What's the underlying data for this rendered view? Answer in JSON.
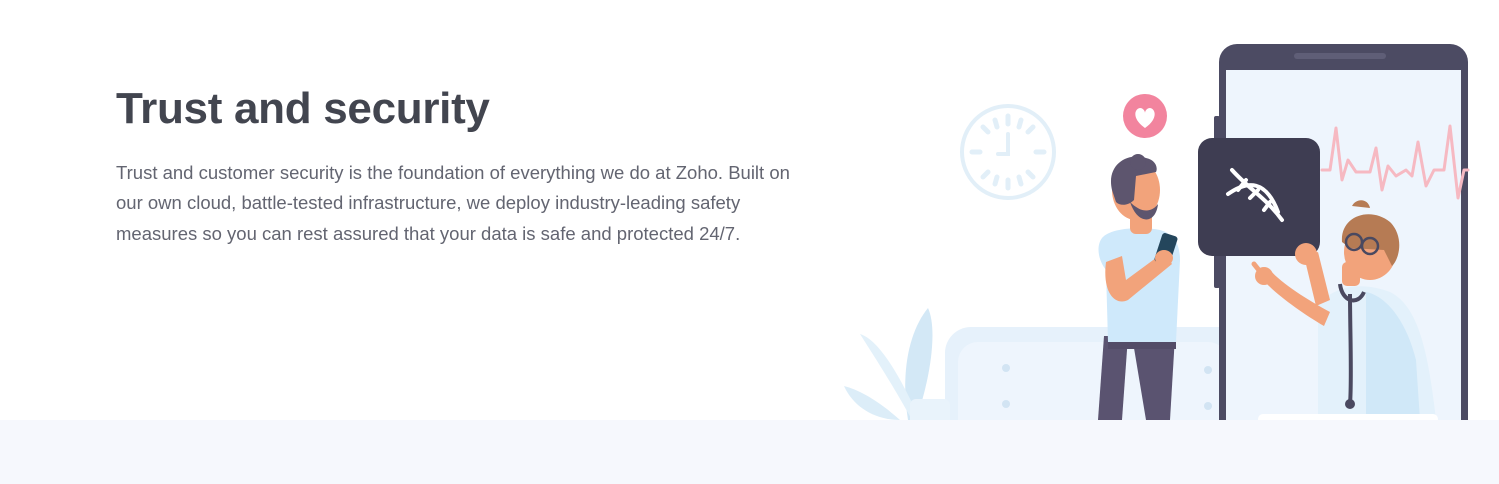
{
  "section": {
    "title": "Trust and security",
    "description": "Trust and customer security is the foundation of everything we do at Zoho. Built on our own cloud, battle-tested infrastructure, we deploy industry-leading safety measures so you can rest assured that your data is safe and protected 24/7."
  },
  "illustration": {
    "icons": [
      "clock-icon",
      "heart-icon",
      "dna-icon"
    ],
    "colors": {
      "heading": "#42454f",
      "body_text": "#636571",
      "phone_frame": "#4c4b63",
      "heart_badge": "#f2849e",
      "heartbeat_line": "#f6b9c2",
      "footer_band": "#f6f8fd"
    }
  }
}
